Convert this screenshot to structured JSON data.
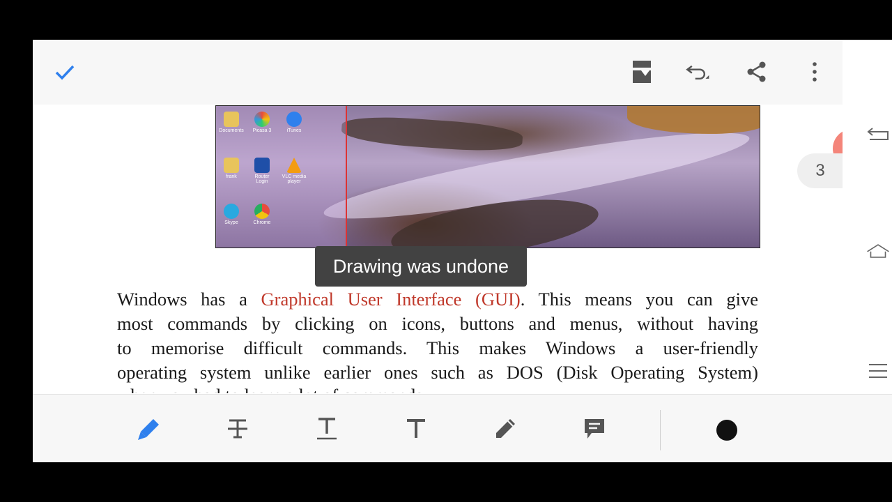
{
  "toast": {
    "text": "Drawing was undone"
  },
  "document": {
    "paragraph_lines": [
      {
        "before": "Windows has a ",
        "highlight": "Graphical User Interface (GUI)",
        "after": ". This means you can give"
      },
      {
        "text": "most commands by clicking on icons, buttons and menus, without having"
      },
      {
        "text": "to memorise difficult commands. This makes Windows a user-friendly"
      },
      {
        "text": "operating system unlike earlier ones such as DOS (Disk Operating System)"
      }
    ],
    "cut_line": "when you had to learn a lot of commands"
  },
  "desktop_icons": [
    "Documents",
    "Picasa 3",
    "iTunes",
    "frank",
    "Router Login",
    "VLC media player",
    "Skype",
    "Chrome"
  ],
  "page_indicator": "3",
  "colors": {
    "accent": "#2f80ed",
    "highlight_text": "#c0392b",
    "toast_bg": "#424242",
    "ink_color": "#111111"
  },
  "icons": {
    "top": [
      "check-icon",
      "page-mode-icon",
      "undo-icon",
      "share-icon",
      "more-vert-icon"
    ],
    "bottom": [
      "highlighter-icon",
      "strikethrough-icon",
      "underline-icon",
      "text-icon",
      "pencil-icon",
      "comment-icon"
    ]
  }
}
